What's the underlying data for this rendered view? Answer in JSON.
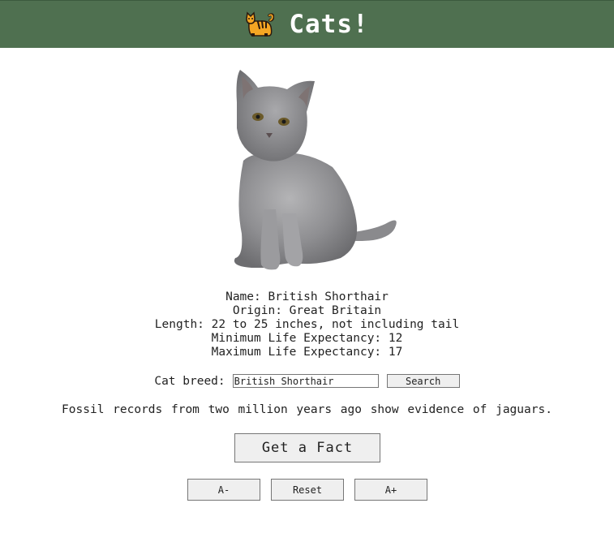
{
  "header": {
    "icon": "cat-icon",
    "title": "Cats!"
  },
  "cat": {
    "image": "british-shorthair-kitten-photo",
    "name_line": "Name: British Shorthair",
    "origin_line": "Origin: Great Britain",
    "length_line": "Length: 22 to 25 inches, not including tail",
    "min_life_line": "Minimum Life Expectancy: 12",
    "max_life_line": "Maximum Life Expectancy: 17"
  },
  "search": {
    "label": "Cat breed:",
    "value": "British Shorthair",
    "button_label": "Search"
  },
  "fact": {
    "text": "Fossil records from two million years ago show evidence of jaguars.",
    "button_label": "Get a Fact"
  },
  "font_size": {
    "decrease_label": "A-",
    "reset_label": "Reset",
    "increase_label": "A+"
  },
  "colors": {
    "header_bg": "#4f7050",
    "header_text": "#ffffff",
    "button_bg": "#efefef"
  }
}
